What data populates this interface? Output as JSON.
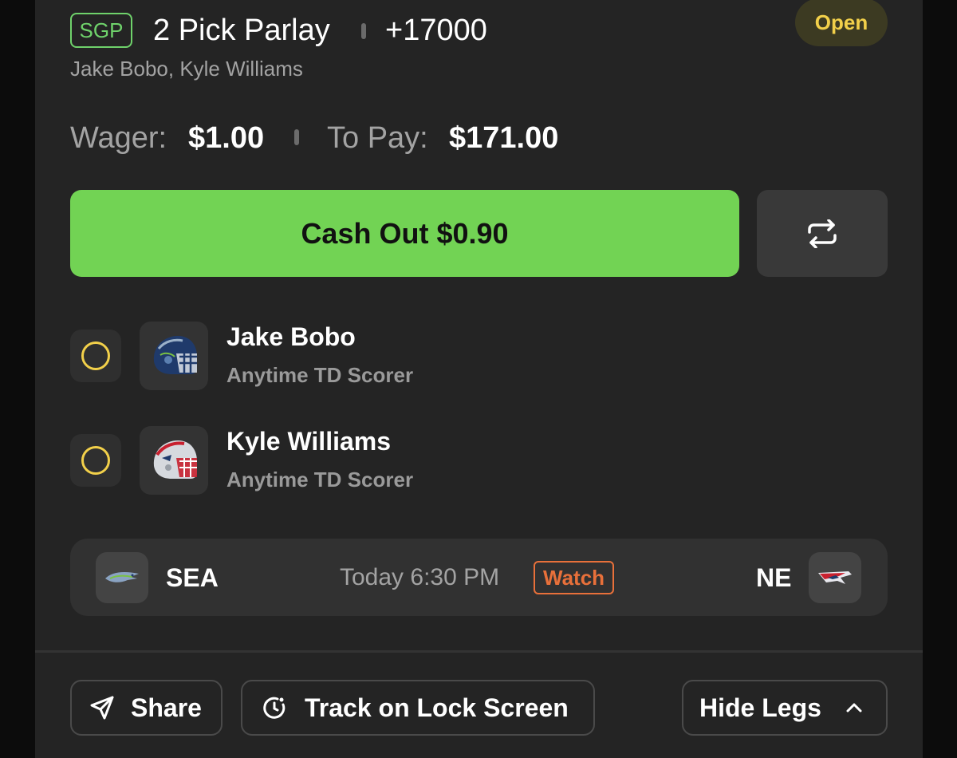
{
  "bet": {
    "badge": "SGP",
    "title": "2 Pick Parlay",
    "odds": "+17000",
    "status": "Open",
    "players": "Jake Bobo, Kyle Williams"
  },
  "wager": {
    "wager_label": "Wager:",
    "wager_value": "$1.00",
    "topay_label": "To Pay:",
    "topay_value": "$171.00"
  },
  "actions": {
    "cashout_label": "Cash Out $0.90",
    "refresh_icon": "swap-arrows-icon"
  },
  "legs": [
    {
      "player": "Jake Bobo",
      "market": "Anytime TD Scorer",
      "team": "SEA",
      "status_icon": "pending-circle-icon"
    },
    {
      "player": "Kyle Williams",
      "market": "Anytime TD Scorer",
      "team": "NE",
      "status_icon": "pending-circle-icon"
    }
  ],
  "game": {
    "away": "SEA",
    "home": "NE",
    "time": "Today 6:30 PM",
    "watch_label": "Watch"
  },
  "footer": {
    "share_label": "Share",
    "track_label": "Track on Lock Screen",
    "hide_legs_label": "Hide Legs"
  },
  "colors": {
    "background": "#242424",
    "accent_green": "#72d354",
    "pending_yellow": "#f2d04a",
    "watch_orange": "#e8703a",
    "sea_navy": "#1f3a6b",
    "ne_red": "#c8202f"
  }
}
